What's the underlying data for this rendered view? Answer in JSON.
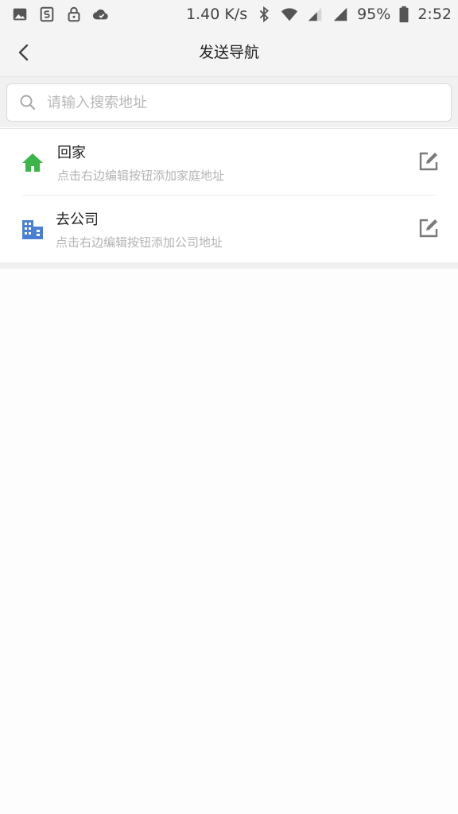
{
  "status_bar": {
    "speed": "1.40 K/s",
    "battery": "95%",
    "time": "2:52",
    "icons_left": [
      "image-icon",
      "sync-icon",
      "lock-icon",
      "cloud-icon"
    ],
    "icons_right": [
      "bluetooth-icon",
      "wifi-icon",
      "signal-icon",
      "signal-icon",
      "battery-icon"
    ]
  },
  "header": {
    "title": "发送导航",
    "back_icon": "chevron-left-icon"
  },
  "search": {
    "placeholder": "请输入搜索地址",
    "value": "",
    "icon": "search-icon"
  },
  "shortcuts": [
    {
      "title": "回家",
      "subtitle": "点击右边编辑按钮添加家庭地址",
      "icon": "home-icon",
      "icon_color": "#3bb54a",
      "action_icon": "edit-icon"
    },
    {
      "title": "去公司",
      "subtitle": "点击右边编辑按钮添加公司地址",
      "icon": "office-building-icon",
      "icon_color": "#4a7fd4",
      "action_icon": "edit-icon"
    }
  ],
  "colors": {
    "header_bg": "#f4f4f4",
    "page_bg": "#fdfdfd",
    "subtitle_text": "#b4b4b4"
  }
}
